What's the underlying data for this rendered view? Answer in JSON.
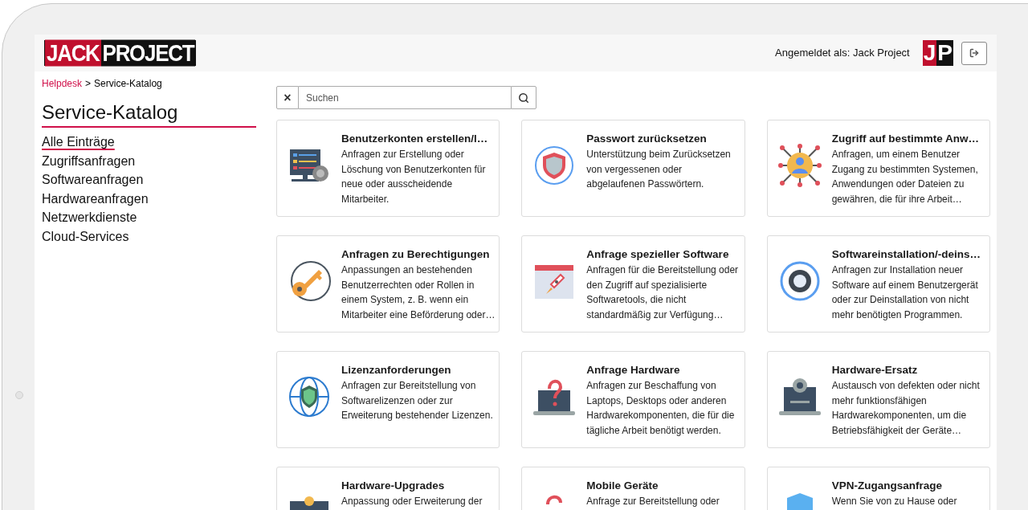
{
  "header": {
    "logo": [
      "JACK",
      "PROJECT"
    ],
    "user_label": "Angemeldet als: Jack Project",
    "avatar_logo": [
      "J",
      "P"
    ]
  },
  "breadcrumb": {
    "link": "Helpdesk",
    "separator": ">",
    "current": "Service-Katalog"
  },
  "sidebar": {
    "title": "Service-Katalog",
    "items": [
      {
        "label": "Alle Einträge",
        "selected": true
      },
      {
        "label": "Zugriffsanfragen",
        "selected": false
      },
      {
        "label": "Softwareanfragen",
        "selected": false
      },
      {
        "label": "Hardwareanfragen",
        "selected": false
      },
      {
        "label": "Netzwerkdienste",
        "selected": false
      },
      {
        "label": "Cloud-Services",
        "selected": false
      }
    ]
  },
  "search": {
    "placeholder": "Suchen",
    "clear": "×"
  },
  "cards": [
    {
      "title": "Benutzerkonten erstellen/l…",
      "description": "Anfragen zur Erstellung oder Löschung von Benutzerkonten für neue oder ausscheidende Mitarbeiter."
    },
    {
      "title": "Passwort zurücksetzen",
      "description": "Unterstützung beim Zurücksetzen von vergessenen oder abgelaufenen Passwörtern."
    },
    {
      "title": "Zugriff auf bestimmte Anw…",
      "description": "Anfragen, um einem Benutzer Zugang zu bestimmten Systemen, Anwendungen oder Dateien zu gewähren, die für ihre Arbeit…"
    },
    {
      "title": "Anfragen zu Berechtigungen",
      "description": "Anpassungen an bestehenden Benutzerrechten oder Rollen in einem System, z. B. wenn ein Mitarbeiter eine Beförderung oder…"
    },
    {
      "title": "Anfrage spezieller Software",
      "description": "Anfragen für die Bereitstellung oder den Zugriff auf spezialisierte Softwaretools, die nicht standardmäßig zur Verfügung…"
    },
    {
      "title": "Softwareinstallation/-deins…",
      "description": "Anfragen zur Installation neuer Software auf einem Benutzergerät oder zur Deinstallation von nicht mehr benötigten Programmen."
    },
    {
      "title": "Lizenzanforderungen",
      "description": "Anfragen zur Bereitstellung von Softwarelizenzen oder zur Erweiterung bestehender Lizenzen."
    },
    {
      "title": "Anfrage Hardware",
      "description": "Anfragen zur Beschaffung von Laptops, Desktops oder anderen Hardwarekomponenten, die für die tägliche Arbeit benötigt werden."
    },
    {
      "title": "Hardware-Ersatz",
      "description": "Austausch von defekten oder nicht mehr funktionsfähigen Hardwarekomponenten, um die Betriebsfähigkeit der Geräte…"
    },
    {
      "title": "Hardware-Upgrades",
      "description": "Anpassung oder Erweiterung der"
    },
    {
      "title": "Mobile Geräte",
      "description": "Anfrage zur Bereitstellung oder"
    },
    {
      "title": "VPN-Zugangsanfrage",
      "description": "Wenn Sie von zu Hause oder"
    }
  ]
}
